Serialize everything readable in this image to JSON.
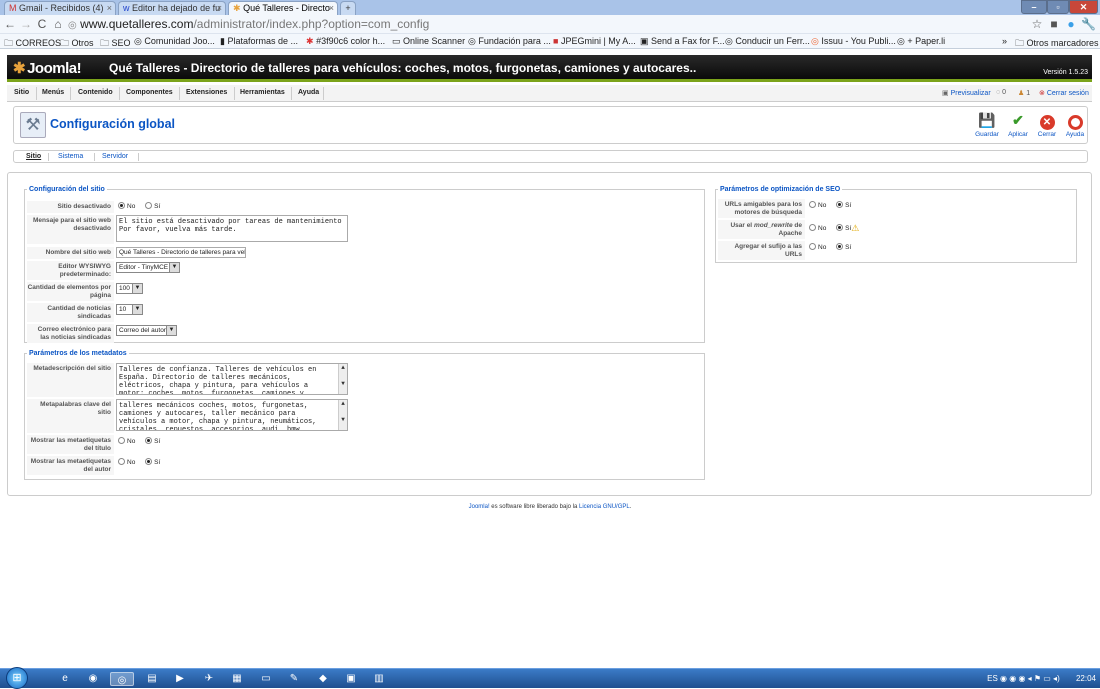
{
  "browser": {
    "tabs": [
      {
        "label": "Gmail - Recibidos (4)"
      },
      {
        "label": "Editor ha dejado de fu"
      },
      {
        "label": "Qué Talleres - Directo"
      }
    ],
    "url_domain": "www.quetalleres.com",
    "url_path": "/administrator/index.php?option=com_config",
    "bookmarks": [
      "CORREOS",
      "Otros",
      "SEO",
      "Comunidad Joo...",
      "Plataformas de ...",
      "#3f90c6 color h...",
      "Online Scanner",
      "Fundación para ...",
      "JPEGmini | My A...",
      "Send a Fax for F...",
      "Conducir un Ferr...",
      "Issuu - You Publi...",
      "+ Paper.li"
    ],
    "other_bookmarks": "Otros marcadores"
  },
  "header": {
    "logo": "Joomla!",
    "site_title": "Qué Talleres - Directorio de talleres para vehículos: coches, motos, furgonetas, camiones y autocares..",
    "version": "Versión 1.5.23"
  },
  "menu": {
    "items": [
      "Sitio",
      "Menús",
      "Contenido",
      "Componentes",
      "Extensiones",
      "Herramientas",
      "Ayuda"
    ],
    "preview": "Previsualizar",
    "messages": "0",
    "users": "1",
    "logout": "Cerrar sesión"
  },
  "toolbar": {
    "title": "Configuración global",
    "save": "Guardar",
    "apply": "Aplicar",
    "close": "Cerrar",
    "help": "Ayuda"
  },
  "subtabs": [
    "Sitio",
    "Sistema",
    "Servidor"
  ],
  "site_config": {
    "legend": "Configuración del sitio",
    "offline_label": "Sitio desactivado",
    "offline_msg_label": "Mensaje para el sitio web desactivado",
    "offline_msg": "El sitio está desactivado por tareas de mantenimiento\nPor favor, vuelva más tarde.",
    "sitename_label": "Nombre del sitio web",
    "sitename": "Qué Talleres - Directorio de talleres para vehícu",
    "editor_label": "Editor WYSIWYG predeterminado:",
    "editor": "Editor - TinyMCE",
    "list_limit_label": "Cantidad de elementos por página",
    "list_limit": "100",
    "feed_limit_label": "Cantidad de noticias sindicadas",
    "feed_limit": "10",
    "feed_email_label": "Correo electrónico para las noticias sindicadas",
    "feed_email": "Correo del autor"
  },
  "meta": {
    "legend": "Parámetros de los metadatos",
    "desc_label": "Metadescripción del sitio",
    "desc": "Talleres de confianza. Talleres de vehículos en España. Directorio de talleres mecánicos, eléctricos, chapa y pintura, para vehículos a motor: coches, motos, furgonetas, camiones y autocares.",
    "keys_label": "Metapalabras clave del sitio",
    "keys": "talleres mecánicos coches, motos, furgonetas, camiones y autocares, taller mecánico para vehículos a motor, chapa y pintura, neumáticos, cristales, repuestos, accesorios, audi, bmw, renault, citroen, peugeot",
    "title_meta_label": "Mostrar las metaetiquetas del título",
    "author_meta_label": "Mostrar las metaetiquetas del autor"
  },
  "seo": {
    "legend": "Parámetros de optimización de SEO",
    "sef_label": "URLs amigables para los motores de búsqueda",
    "rewrite_label_a": "Usar el ",
    "rewrite_label_em": "mod_rewrite",
    "rewrite_label_b": " de Apache",
    "suffix_label": "Agregar el sufijo a las URLs"
  },
  "radio": {
    "no": "No",
    "yes": "Sí"
  },
  "footer": {
    "joomla": "Joomla!",
    "text": " es software libre liberado bajo la ",
    "license": "Licencia GNU/GPL",
    "end": "."
  },
  "taskbar": {
    "lang": "ES",
    "time": "22:04"
  }
}
